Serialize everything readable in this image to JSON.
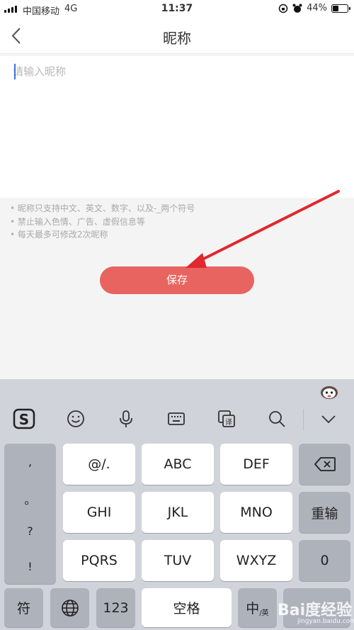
{
  "status_bar": {
    "carrier": "中国移动",
    "network": "4G",
    "time": "11:37",
    "battery": "44%",
    "battery_level": 0.44
  },
  "nav": {
    "title": "昵称"
  },
  "input": {
    "placeholder": "请输入昵称",
    "value": ""
  },
  "notes": [
    "昵称只支持中文、英文、数字、以及-_两个符号",
    "禁止输入色情、广告、虚假信息等",
    "每天最多可修改2次昵称"
  ],
  "save_button": {
    "label": "保存",
    "color": "#e86460"
  },
  "annotation": {
    "color": "#e0282e"
  },
  "keyboard": {
    "left_column": [
      ",",
      "。",
      "?",
      "!"
    ],
    "row1": [
      "@/.",
      "ABC",
      "DEF"
    ],
    "row2": [
      "GHI",
      "JKL",
      "MNO"
    ],
    "row3": [
      "PQRS",
      "TUV",
      "WXYZ"
    ],
    "reenter": "重输",
    "zero": "0",
    "bottom": {
      "symbol": "符",
      "num": "123",
      "space": "空格",
      "lang": "中",
      "lang_sub": "/英"
    }
  },
  "watermark": {
    "main": "Bai度经验",
    "sub": "jingyan.baidu.com"
  }
}
